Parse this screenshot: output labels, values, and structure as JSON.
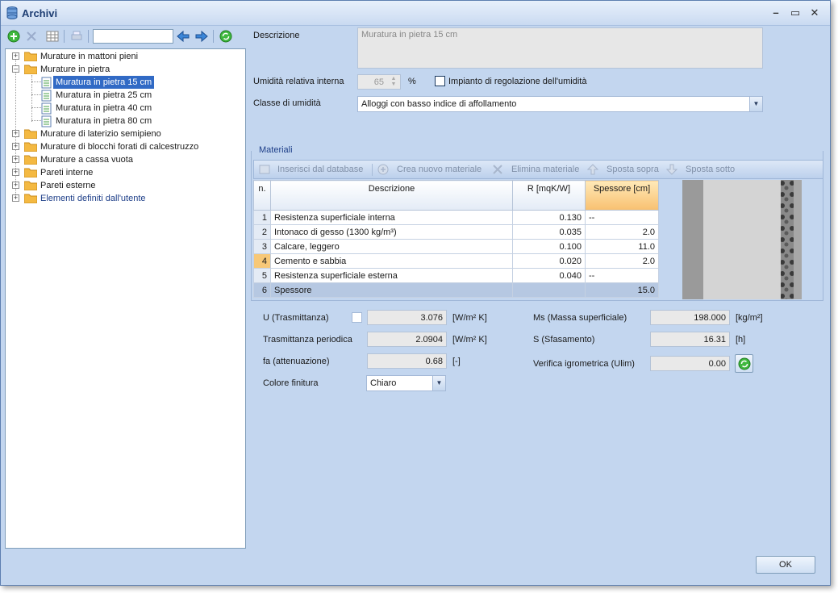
{
  "window": {
    "title": "Archivi"
  },
  "tree": {
    "items": [
      {
        "label": "Murature in mattoni pieni"
      },
      {
        "label": "Murature in pietra"
      },
      {
        "label": "Muratura in pietra 15 cm"
      },
      {
        "label": "Muratura in pietra 25 cm"
      },
      {
        "label": "Muratura in pietra 40 cm"
      },
      {
        "label": "Muratura in pietra 80 cm"
      },
      {
        "label": "Murature di laterizio semipieno"
      },
      {
        "label": "Murature di blocchi forati di calcestruzzo"
      },
      {
        "label": "Murature a cassa vuota"
      },
      {
        "label": "Pareti interne"
      },
      {
        "label": "Pareti esterne"
      },
      {
        "label": "Elementi definiti dall'utente"
      }
    ]
  },
  "form": {
    "descrizione_label": "Descrizione",
    "descrizione_value": "Muratura in pietra 15 cm",
    "umidita_label": "Umidità relativa interna",
    "umidita_value": "65",
    "umidita_unit": "%",
    "impianto_label": "Impianto di regolazione dell'umidità",
    "classe_label": "Classe di umidità",
    "classe_value": "Alloggi con basso indice di affollamento"
  },
  "materiali": {
    "title": "Materiali",
    "toolbar": {
      "inserisci": "Inserisci dal database",
      "crea": "Crea nuovo materiale",
      "elimina": "Elimina materiale",
      "sopra": "Sposta sopra",
      "sotto": "Sposta sotto"
    },
    "columns": {
      "n": "n.",
      "descrizione": "Descrizione",
      "r": "R [mqK/W]",
      "spessore": "Spessore [cm]"
    },
    "rows": [
      {
        "n": "1",
        "descrizione": "Resistenza superficiale interna",
        "r": "0.130",
        "spessore": "--"
      },
      {
        "n": "2",
        "descrizione": "Intonaco di gesso (1300 kg/m³)",
        "r": "0.035",
        "spessore": "2.0"
      },
      {
        "n": "3",
        "descrizione": "Calcare, leggero",
        "r": "0.100",
        "spessore": "11.0"
      },
      {
        "n": "4",
        "descrizione": "Cemento e sabbia",
        "r": "0.020",
        "spessore": "2.0"
      },
      {
        "n": "5",
        "descrizione": "Resistenza superficiale esterna",
        "r": "0.040",
        "spessore": "--"
      },
      {
        "n": "6",
        "descrizione": "Spessore",
        "r": "",
        "spessore": "15.0"
      }
    ]
  },
  "results": {
    "u_label": "U (Trasmittanza)",
    "u_value": "3.076",
    "u_unit": "[W/m² K]",
    "tp_label": "Trasmittanza periodica",
    "tp_value": "2.0904",
    "tp_unit": "[W/m² K]",
    "fa_label": "fa (attenuazione)",
    "fa_value": "0.68",
    "fa_unit": "[-]",
    "colore_label": "Colore finitura",
    "colore_value": "Chiaro",
    "ms_label": "Ms (Massa superficiale)",
    "ms_value": "198.000",
    "ms_unit": "[kg/m²]",
    "s_label": "S (Sfasamento)",
    "s_value": "16.31",
    "s_unit": "[h]",
    "ver_label": "Verifica igrometrica (Ulim)",
    "ver_value": "0.00"
  },
  "buttons": {
    "ok": "OK"
  }
}
